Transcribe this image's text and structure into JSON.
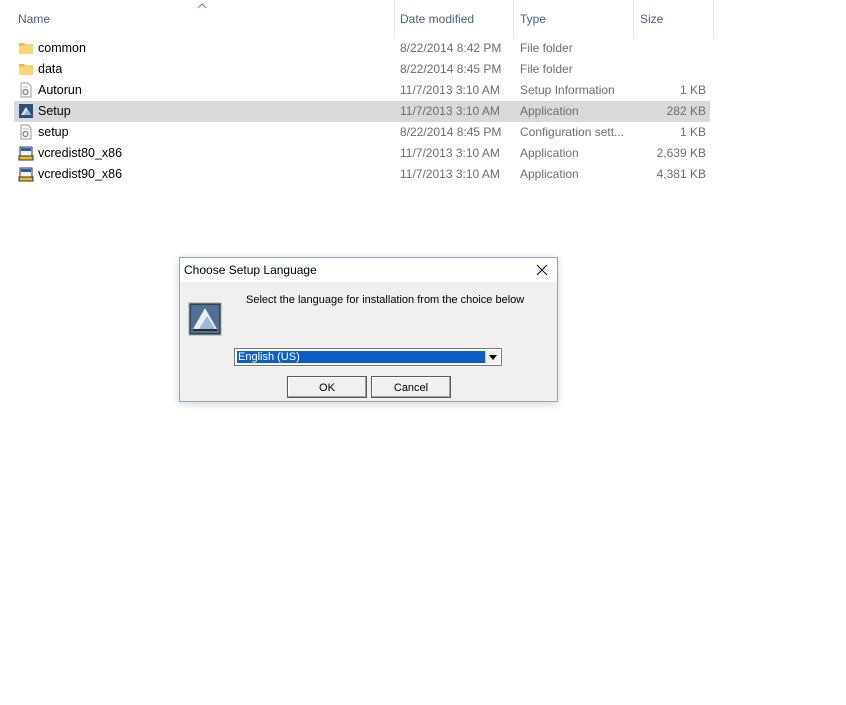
{
  "columns": {
    "name": "Name",
    "date": "Date modified",
    "type": "Type",
    "size": "Size"
  },
  "files": [
    {
      "name": "common",
      "date": "8/22/2014 8:42 PM",
      "type": "File folder",
      "size": "",
      "icon": "folder-icon"
    },
    {
      "name": "data",
      "date": "8/22/2014 8:45 PM",
      "type": "File folder",
      "size": "",
      "icon": "folder-icon"
    },
    {
      "name": "Autorun",
      "date": "11/7/2013 3:10 AM",
      "type": "Setup Information",
      "size": "1 KB",
      "icon": "settings-file-icon"
    },
    {
      "name": "Setup",
      "date": "11/7/2013 3:10 AM",
      "type": "Application",
      "size": "282 KB",
      "icon": "setup-app-icon",
      "selected": true
    },
    {
      "name": "setup",
      "date": "8/22/2014 8:45 PM",
      "type": "Configuration sett...",
      "size": "1 KB",
      "icon": "settings-file-icon"
    },
    {
      "name": "vcredist80_x86",
      "date": "11/7/2013 3:10 AM",
      "type": "Application",
      "size": "2,639 KB",
      "icon": "installer-app-icon"
    },
    {
      "name": "vcredist90_x86",
      "date": "11/7/2013 3:10 AM",
      "type": "Application",
      "size": "4,381 KB",
      "icon": "installer-app-icon"
    }
  ],
  "dialog": {
    "title": "Choose Setup Language",
    "prompt": "Select the language for installation from the choice below",
    "selected_language": "English (US)",
    "ok_label": "OK",
    "cancel_label": "Cancel"
  },
  "colors": {
    "selection_row": "#d9d9d9",
    "select_highlight": "#0a5fc5",
    "dialog_border": "#8aa7c8"
  }
}
